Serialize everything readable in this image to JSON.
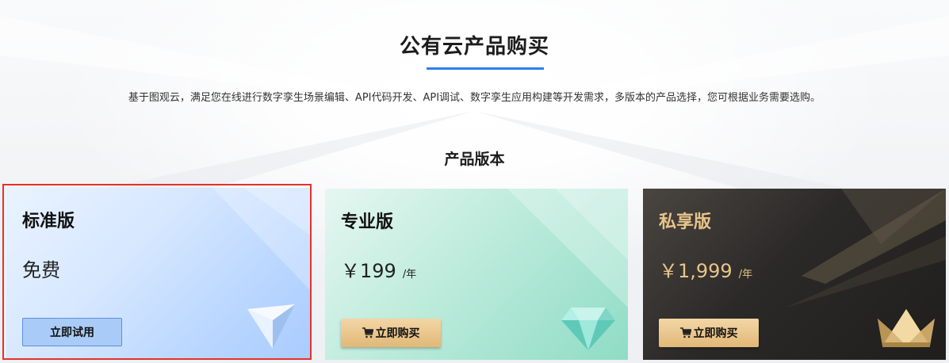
{
  "header": {
    "title": "公有云产品购买",
    "subtitle": "基于图观云，满足您在线进行数字孪生场景编辑、API代码开发、API调试、数字孪生应用构建等开发需求，多版本的产品选择，您可根据业务需要选购。",
    "section_title": "产品版本"
  },
  "plans": [
    {
      "name": "标准版",
      "price": "免费",
      "unit": "",
      "button": "立即试用",
      "selected": true
    },
    {
      "name": "专业版",
      "price": "￥199",
      "unit": "/年",
      "button": "立即购买",
      "selected": false
    },
    {
      "name": "私享版",
      "price": "￥1,999",
      "unit": "/年",
      "button": "立即购买",
      "selected": false
    }
  ],
  "icons": {
    "standard": "crystal-pyramid-icon",
    "professional": "diamond-icon",
    "private": "crown-icon",
    "cart": "cart-icon"
  },
  "colors": {
    "accent": "#2e7ef0",
    "selected_border": "#e4322a",
    "gold": "#e8c48a"
  }
}
